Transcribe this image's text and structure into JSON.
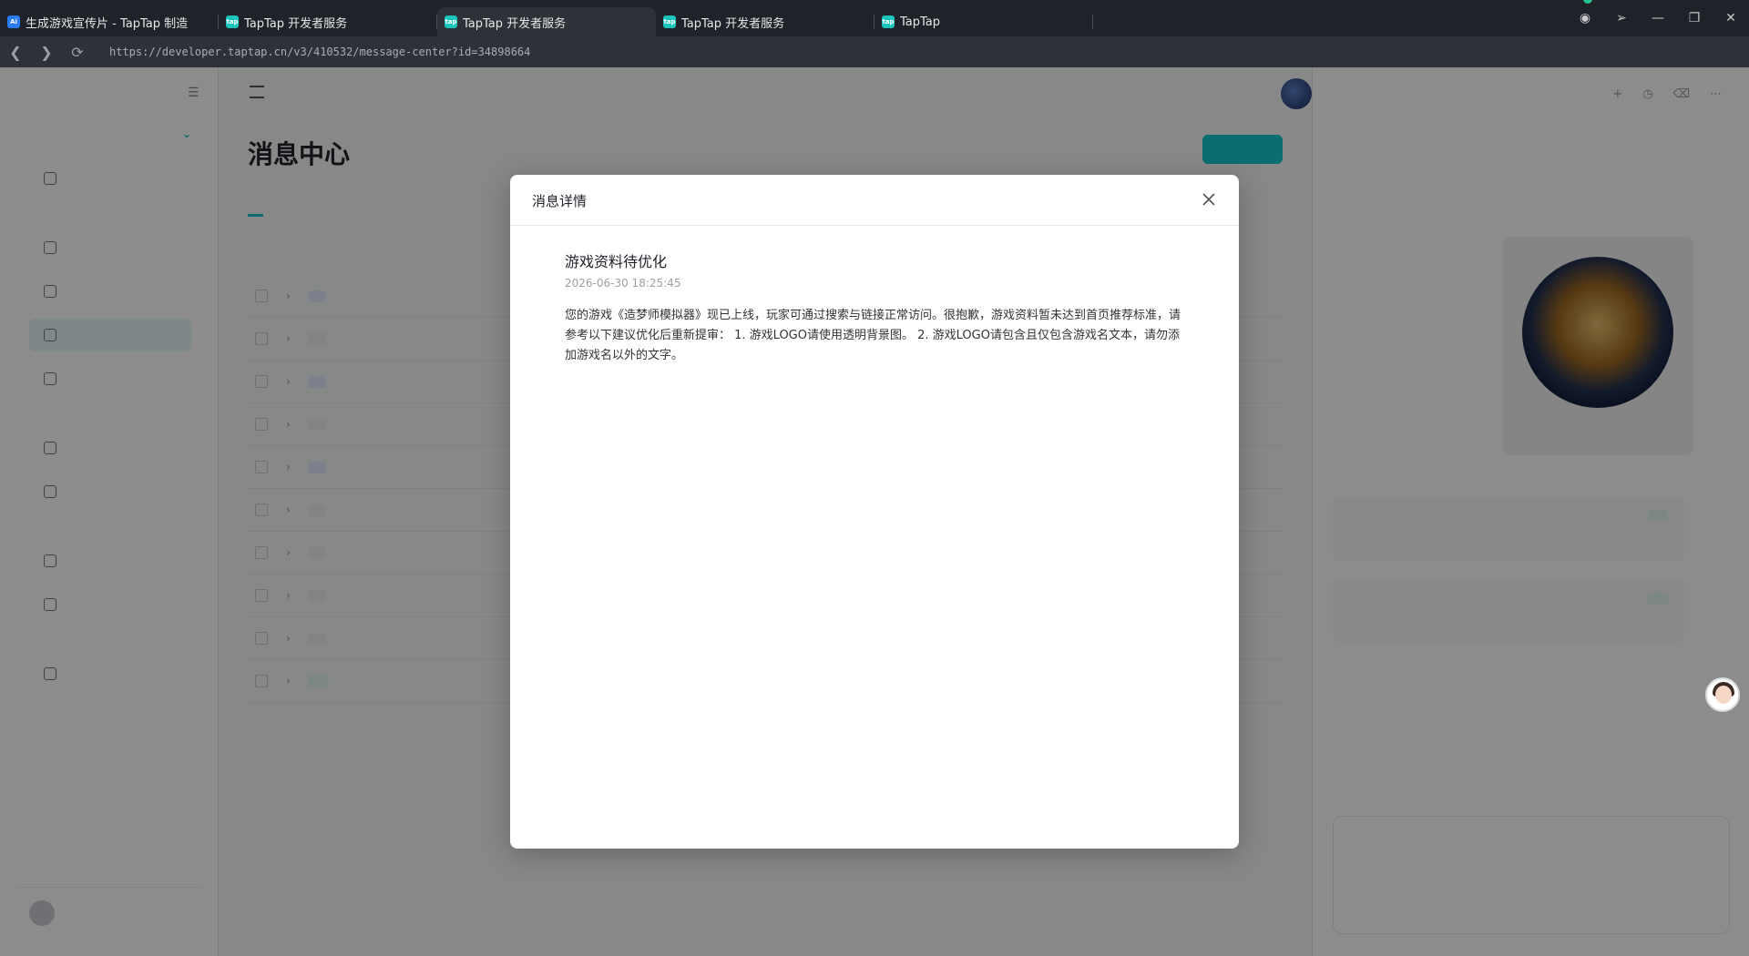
{
  "browser": {
    "tabs": [
      {
        "label": "生成游戏宣传片 - TapTap 制造",
        "active": false,
        "fav": "Ai"
      },
      {
        "label": "TapTap 开发者服务",
        "active": false,
        "fav": "tap"
      },
      {
        "label": "TapTap 开发者服务",
        "active": true,
        "fav": "tap"
      },
      {
        "label": "TapTap 开发者服务",
        "active": false,
        "fav": "tap"
      },
      {
        "label": "TapTap",
        "active": false,
        "fav": "tap"
      }
    ],
    "url": "https://developer.taptap.cn/v3/410532/message-center?id=34898664",
    "window_controls": [
      "extension-icon",
      "pin-icon",
      "minimize-icon",
      "restore-icon",
      "close-icon"
    ]
  },
  "modal": {
    "title": "消息详情",
    "message": {
      "title": "游戏资料待优化",
      "time": "2026-06-30 18:25:45",
      "body": "您的游戏《造梦师模拟器》现已上线，玩家可通过搜索与链接正常访问。很抱歉，游戏资料暂未达到首页推荐标准，请参考以下建议优化后重新提审： 1. 游戏LOGO请使用透明背景图。 2. 游戏LOGO请包含且仅包含游戏名文本，请勿添加游戏名以外的文字。"
    }
  },
  "page": {
    "title": "消息中心"
  },
  "colors": {
    "accent": "#15c5ce",
    "overlay": "rgba(0,0,0,0.45)",
    "tab_bar": "#1f2329"
  }
}
